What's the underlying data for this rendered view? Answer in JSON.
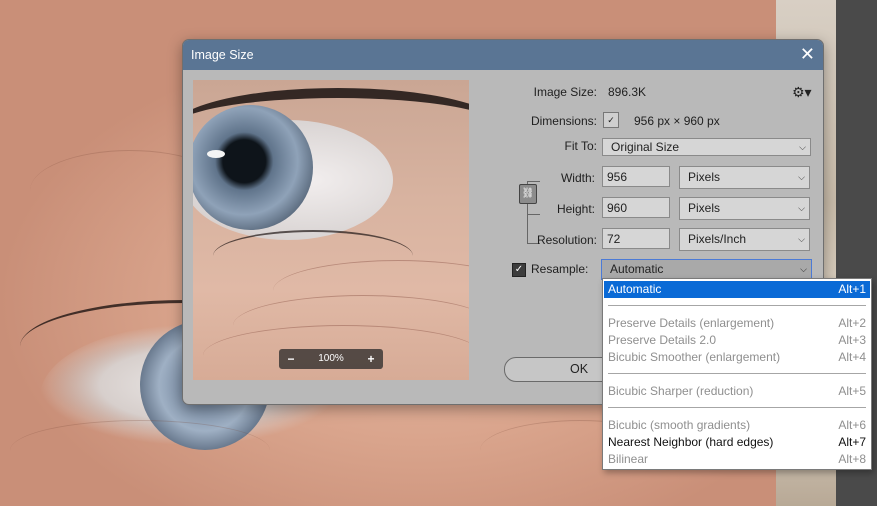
{
  "dialog": {
    "title": "Image Size",
    "image_size_label": "Image Size:",
    "image_size_value": "896.3K",
    "dimensions_label": "Dimensions:",
    "dimensions_value": "956 px  ×  960 px",
    "fit_to_label": "Fit To:",
    "fit_to_value": "Original Size",
    "width_label": "Width:",
    "width_value": "956",
    "width_unit": "Pixels",
    "height_label": "Height:",
    "height_value": "960",
    "height_unit": "Pixels",
    "resolution_label": "Resolution:",
    "resolution_value": "72",
    "resolution_unit": "Pixels/Inch",
    "resample_label": "Resample:",
    "resample_value": "Automatic",
    "ok_label": "OK",
    "zoom_value": "100%"
  },
  "dropdown": {
    "items": [
      {
        "label": "Automatic",
        "shortcut": "Alt+1"
      },
      {
        "label": "Preserve Details (enlargement)",
        "shortcut": "Alt+2"
      },
      {
        "label": "Preserve Details 2.0",
        "shortcut": "Alt+3"
      },
      {
        "label": "Bicubic Smoother (enlargement)",
        "shortcut": "Alt+4"
      },
      {
        "label": "Bicubic Sharper (reduction)",
        "shortcut": "Alt+5"
      },
      {
        "label": "Bicubic (smooth gradients)",
        "shortcut": "Alt+6"
      },
      {
        "label": "Nearest Neighbor (hard edges)",
        "shortcut": "Alt+7"
      },
      {
        "label": "Bilinear",
        "shortcut": "Alt+8"
      }
    ]
  },
  "colors": {
    "titlebar": "#5a7594",
    "dialog_bg": "#b9b9b9",
    "selection": "#0a6ad6"
  },
  "icons": {
    "close": "close-icon",
    "gear": "gear-icon",
    "link": "link-icon",
    "chevron": "chevron-down-icon",
    "check": "checkmark-icon"
  }
}
